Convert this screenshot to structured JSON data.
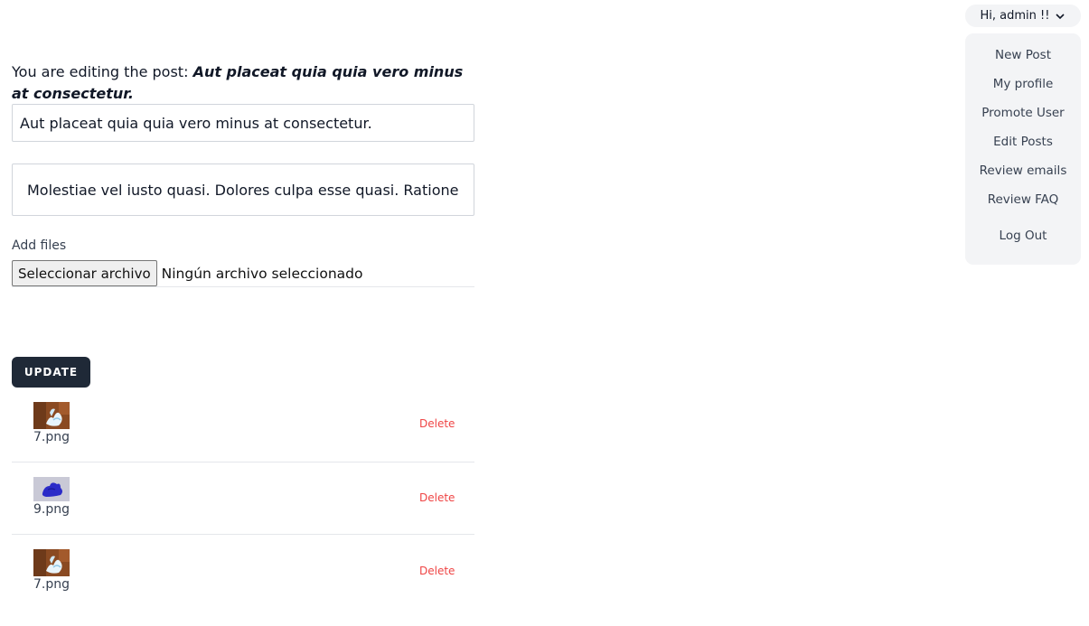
{
  "user_menu": {
    "greeting": "Hi, admin !!",
    "toggle_icon": "chevron-down-icon",
    "items": [
      {
        "label": "New Post"
      },
      {
        "label": "My profile"
      },
      {
        "label": "Promote User"
      },
      {
        "label": "Edit Posts"
      },
      {
        "label": "Review emails"
      },
      {
        "label": "Review FAQ"
      },
      {
        "label": "Log Out"
      }
    ]
  },
  "editor": {
    "heading_prefix": "You are editing the post:",
    "heading_post_title": "Aut placeat quia quia vero minus at consectetur.",
    "title_value": "Aut placeat quia quia vero minus at consectetur.",
    "body_value": "Molestiae vel iusto quasi. Dolores culpa esse quasi. Ratione facere",
    "files_label": "Add files",
    "file_button_label": "Seleccionar archivo",
    "file_status": "Ningún archivo seleccionado",
    "update_label": "UPDATE"
  },
  "attachments": [
    {
      "name": "7.png",
      "thumb": "swan-image",
      "delete_label": "Delete"
    },
    {
      "name": "9.png",
      "thumb": "blue-blob-image",
      "delete_label": "Delete"
    },
    {
      "name": "7.png",
      "thumb": "swan-image",
      "delete_label": "Delete"
    }
  ],
  "colors": {
    "update_button_bg": "#1f2937",
    "delete_text": "#ef4444",
    "menu_bg": "#f3f4f6"
  }
}
